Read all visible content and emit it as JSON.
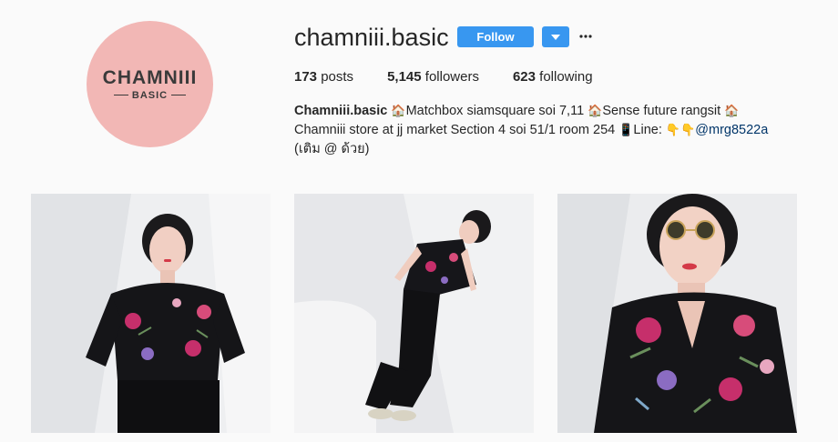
{
  "avatar": {
    "logo_main": "CHAMNIII",
    "logo_sub": "BASIC"
  },
  "header": {
    "username": "chamniii.basic",
    "follow_label": "Follow",
    "dropdown_icon": "chevron-down-icon",
    "more_icon": "more-options-icon",
    "more_glyph": "•••"
  },
  "stats": {
    "posts_count": "173",
    "posts_label": " posts",
    "followers_count": "5,145",
    "followers_label": " followers",
    "following_count": "623",
    "following_label": " following"
  },
  "bio": {
    "name": "Chamniii.basic",
    "line1": "Matchbox siamsquare soi 7,11 ",
    "line1b": "Sense future rangsit ",
    "line2": "Chamniii store at jj market Section 4 soi 51/1 room 254 ",
    "line2b": "Line: ",
    "mention": "@mrg8522a",
    "line3": "(เติม @ ด้วย)",
    "house_emoji": "🏠",
    "phone_emoji": "📱",
    "point_emoji": "👇👇"
  },
  "colors": {
    "follow_blue": "#3897f0",
    "avatar_pink": "#f2b7b5",
    "mention": "#003569"
  },
  "posts": [
    {
      "label": "photo-post-1"
    },
    {
      "label": "photo-post-2"
    },
    {
      "label": "photo-post-3"
    }
  ]
}
